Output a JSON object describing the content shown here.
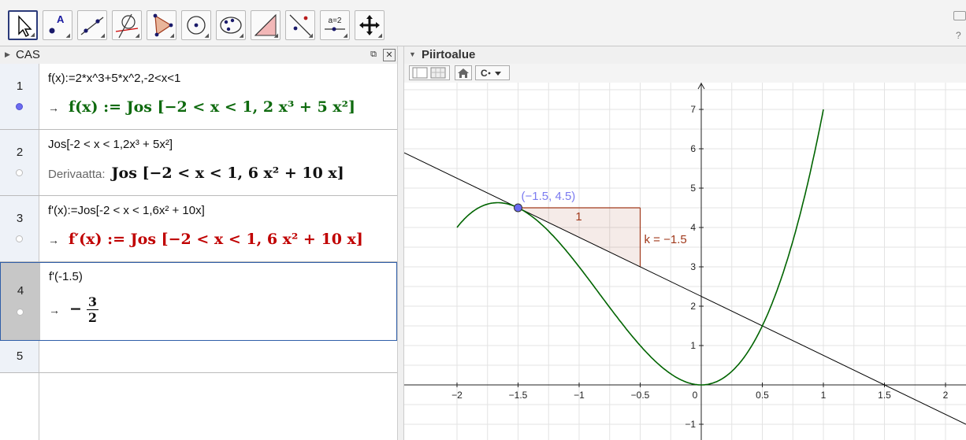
{
  "toolbar": {
    "tools": [
      {
        "icon": "move-arrow-icon",
        "active": true
      },
      {
        "icon": "point-icon"
      },
      {
        "icon": "line-through-points-icon"
      },
      {
        "icon": "perpendicular-line-icon"
      },
      {
        "icon": "polygon-icon"
      },
      {
        "icon": "circle-center-point-icon"
      },
      {
        "icon": "conic-five-points-icon"
      },
      {
        "icon": "angle-icon"
      },
      {
        "icon": "reflect-line-icon"
      },
      {
        "icon": "slider-icon",
        "label": "a=2"
      },
      {
        "icon": "move-graphics-view-icon"
      }
    ]
  },
  "cas": {
    "title": "CAS",
    "rows": [
      {
        "num": "1",
        "input": "f(x):=2*x^3+5*x^2,-2<x<1",
        "arrow": "→",
        "output": "f(x) := Jos [−2 < x < 1, 2 x³ + 5 x²]",
        "marked": true
      },
      {
        "num": "2",
        "input": "Jos[-2  <  x  <  1,2x³ + 5x²]",
        "prefix": "Derivaatta:",
        "output": "Jos [−2 < x < 1, 6 x² + 10 x]",
        "marked": false
      },
      {
        "num": "3",
        "input": "f'(x):=Jos[-2  <  x  <  1,6x² + 10x]",
        "arrow": "→",
        "output": "f′(x) := Jos [−2 < x < 1, 6 x² + 10 x]",
        "marked": false
      },
      {
        "num": "4",
        "input": "f'(-1.5)",
        "arrow": "→",
        "output_sign": "−",
        "output_num": "3",
        "output_den": "2",
        "marked": false
      },
      {
        "num": "5",
        "input": "",
        "output": ""
      }
    ]
  },
  "graphics": {
    "title": "Piirtoalue",
    "point_label": "(-1.5, 4.5)",
    "slope_run_label": "1",
    "slope_label": "k = -1.5",
    "x_ticks": [
      "-2",
      "-1.5",
      "-1",
      "-0.5",
      "0",
      "0.5",
      "1",
      "1.5",
      "2"
    ],
    "y_ticks": [
      "7",
      "6",
      "5",
      "4",
      "3",
      "2",
      "1",
      "-1"
    ],
    "colors": {
      "curve": "#006400",
      "tangent": "#000000",
      "point": "#6a6af2",
      "point_label": "#7b7bf0",
      "triangle": "#a0391b"
    }
  }
}
